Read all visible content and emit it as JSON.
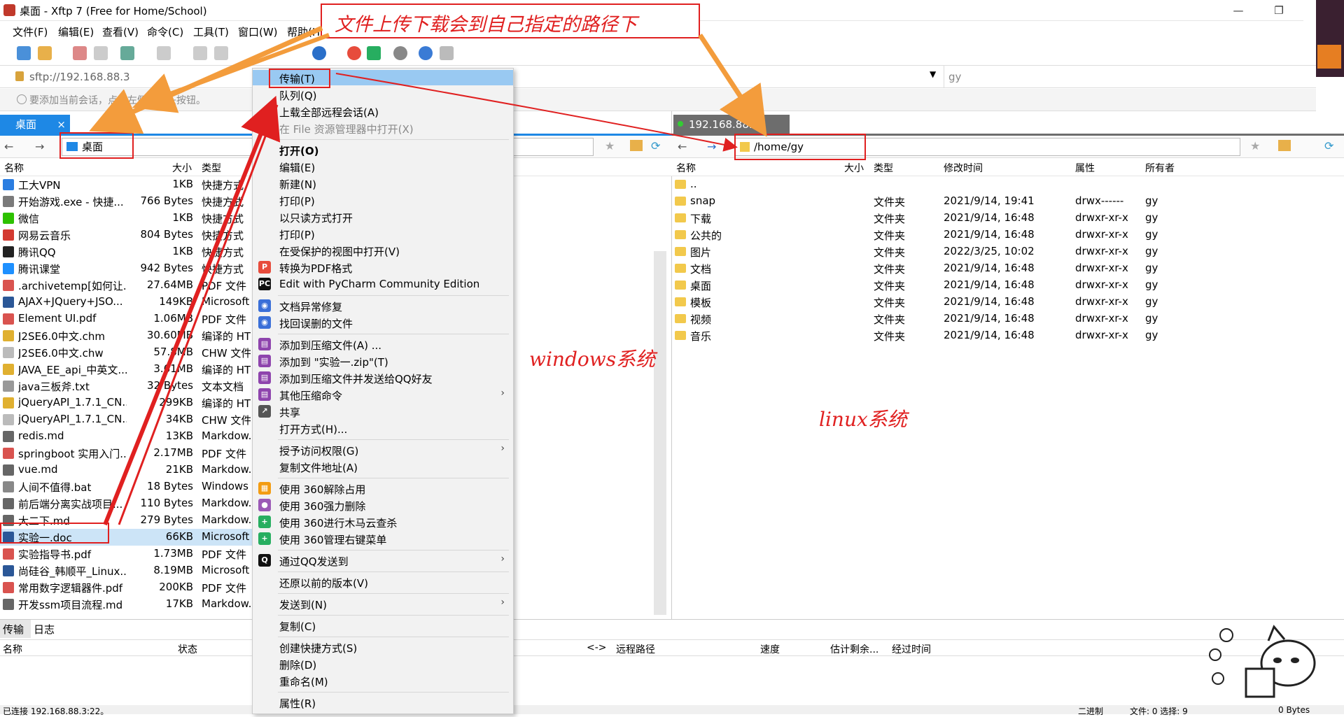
{
  "window": {
    "title": "桌面 - Xftp 7 (Free for Home/School)",
    "min": "—",
    "max": "❐",
    "close": "✕"
  },
  "menu": [
    "文件(F)",
    "编辑(E)",
    "查看(V)",
    "命令(C)",
    "工具(T)",
    "窗口(W)",
    "帮助(H)"
  ],
  "address": {
    "url": "sftp://192.168.88.3",
    "right_value": "gy"
  },
  "hint": "要添加当前会话，点击左侧的箭头按钮。",
  "left": {
    "tab": "桌面",
    "path": "桌面",
    "columns": [
      "名称",
      "大小",
      "类型"
    ],
    "files": [
      {
        "name": "工大VPN",
        "size": "1KB",
        "type": "快捷方式",
        "color": "#2a7de1"
      },
      {
        "name": "开始游戏.exe - 快捷...",
        "size": "766 Bytes",
        "type": "快捷方式",
        "color": "#7a7a7a"
      },
      {
        "name": "微信",
        "size": "1KB",
        "type": "快捷方式",
        "color": "#2dc100"
      },
      {
        "name": "网易云音乐",
        "size": "804 Bytes",
        "type": "快捷方式",
        "color": "#d33a31"
      },
      {
        "name": "腾讯QQ",
        "size": "1KB",
        "type": "快捷方式",
        "color": "#222"
      },
      {
        "name": "腾讯课堂",
        "size": "942 Bytes",
        "type": "快捷方式",
        "color": "#1e90ff"
      },
      {
        "name": ".archivetemp[如何让...",
        "size": "27.64MB",
        "type": "PDF 文件",
        "color": "#d9534f"
      },
      {
        "name": "AJAX+JQuery+JSO...",
        "size": "149KB",
        "type": "Microsoft",
        "color": "#2b5797"
      },
      {
        "name": "Element UI.pdf",
        "size": "1.06MB",
        "type": "PDF 文件",
        "color": "#d9534f"
      },
      {
        "name": "J2SE6.0中文.chm",
        "size": "30.60MB",
        "type": "编译的 HT",
        "color": "#e0b030"
      },
      {
        "name": "J2SE6.0中文.chw",
        "size": "57.8MB",
        "type": "CHW 文件",
        "color": "#bbb"
      },
      {
        "name": "JAVA_EE_api_中英文...",
        "size": "3.61MB",
        "type": "编译的 HT",
        "color": "#e0b030"
      },
      {
        "name": "java三板斧.txt",
        "size": "32 Bytes",
        "type": "文本文档",
        "color": "#999"
      },
      {
        "name": "jQueryAPI_1.7.1_CN...",
        "size": "299KB",
        "type": "编译的 HT",
        "color": "#e0b030"
      },
      {
        "name": "jQueryAPI_1.7.1_CN...",
        "size": "34KB",
        "type": "CHW 文件",
        "color": "#bbb"
      },
      {
        "name": "redis.md",
        "size": "13KB",
        "type": "Markdow.",
        "color": "#666"
      },
      {
        "name": "springboot 实用入门...",
        "size": "2.17MB",
        "type": "PDF 文件",
        "color": "#d9534f"
      },
      {
        "name": "vue.md",
        "size": "21KB",
        "type": "Markdow.",
        "color": "#666"
      },
      {
        "name": "人间不值得.bat",
        "size": "18 Bytes",
        "type": "Windows",
        "color": "#888"
      },
      {
        "name": "前后端分离实战项目...",
        "size": "110 Bytes",
        "type": "Markdow.",
        "color": "#666"
      },
      {
        "name": "大二下.md",
        "size": "279 Bytes",
        "type": "Markdow.",
        "color": "#666"
      },
      {
        "name": "实验一.doc",
        "size": "66KB",
        "type": "Microsoft",
        "color": "#2b5797"
      },
      {
        "name": "实验指导书.pdf",
        "size": "1.73MB",
        "type": "PDF 文件",
        "color": "#d9534f"
      },
      {
        "name": "尚硅谷_韩顺平_Linux...",
        "size": "8.19MB",
        "type": "Microsoft",
        "color": "#2b5797"
      },
      {
        "name": "常用数字逻辑器件.pdf",
        "size": "200KB",
        "type": "PDF 文件",
        "color": "#d9534f"
      },
      {
        "name": "开发ssm项目流程.md",
        "size": "17KB",
        "type": "Markdow.",
        "color": "#666"
      }
    ]
  },
  "right": {
    "tab": "192.168.88.3",
    "path": "/home/gy",
    "columns": [
      "名称",
      "大小",
      "类型",
      "修改时间",
      "属性",
      "所有者"
    ],
    "files": [
      {
        "name": "..",
        "type": "",
        "time": "",
        "attr": "",
        "owner": ""
      },
      {
        "name": "snap",
        "type": "文件夹",
        "time": "2021/9/14, 19:41",
        "attr": "drwx------",
        "owner": "gy"
      },
      {
        "name": "下载",
        "type": "文件夹",
        "time": "2021/9/14, 16:48",
        "attr": "drwxr-xr-x",
        "owner": "gy"
      },
      {
        "name": "公共的",
        "type": "文件夹",
        "time": "2021/9/14, 16:48",
        "attr": "drwxr-xr-x",
        "owner": "gy"
      },
      {
        "name": "图片",
        "type": "文件夹",
        "time": "2022/3/25, 10:02",
        "attr": "drwxr-xr-x",
        "owner": "gy"
      },
      {
        "name": "文档",
        "type": "文件夹",
        "time": "2021/9/14, 16:48",
        "attr": "drwxr-xr-x",
        "owner": "gy"
      },
      {
        "name": "桌面",
        "type": "文件夹",
        "time": "2021/9/14, 16:48",
        "attr": "drwxr-xr-x",
        "owner": "gy"
      },
      {
        "name": "模板",
        "type": "文件夹",
        "time": "2021/9/14, 16:48",
        "attr": "drwxr-xr-x",
        "owner": "gy"
      },
      {
        "name": "视频",
        "type": "文件夹",
        "time": "2021/9/14, 16:48",
        "attr": "drwxr-xr-x",
        "owner": "gy"
      },
      {
        "name": "音乐",
        "type": "文件夹",
        "time": "2021/9/14, 16:48",
        "attr": "drwxr-xr-x",
        "owner": "gy"
      }
    ]
  },
  "context_menu": [
    {
      "label": "传输(T)",
      "style": "hl"
    },
    {
      "label": "队列(Q)"
    },
    {
      "label": "上载全部远程会话(A)"
    },
    {
      "label": "在 File 资源管理器中打开(X)",
      "style": "dis"
    },
    {
      "sep": true
    },
    {
      "label": "打开(O)",
      "style": "bold"
    },
    {
      "label": "编辑(E)"
    },
    {
      "label": "新建(N)"
    },
    {
      "label": "打印(P)"
    },
    {
      "label": "以只读方式打开"
    },
    {
      "label": "打印(P)"
    },
    {
      "label": "在受保护的视图中打开(V)"
    },
    {
      "label": "转换为PDF格式",
      "icon": "P",
      "color": "#e74c3c"
    },
    {
      "label": "Edit with PyCharm Community Edition",
      "icon": "PC",
      "color": "#111"
    },
    {
      "sep": true
    },
    {
      "label": "文档异常修复",
      "icon": "◉",
      "color": "#3a6fd8"
    },
    {
      "label": "找回误删的文件",
      "icon": "◉",
      "color": "#3a6fd8"
    },
    {
      "sep": true
    },
    {
      "label": "添加到压缩文件(A) ...",
      "icon": "▤",
      "color": "#8e44ad"
    },
    {
      "label": "添加到 \"实验一.zip\"(T)",
      "icon": "▤",
      "color": "#8e44ad"
    },
    {
      "label": "添加到压缩文件并发送给QQ好友",
      "icon": "▤",
      "color": "#8e44ad"
    },
    {
      "label": "其他压缩命令",
      "icon": "▤",
      "color": "#8e44ad",
      "arrow": "›"
    },
    {
      "label": "共享",
      "icon": "↗",
      "color": "#555"
    },
    {
      "label": "打开方式(H)..."
    },
    {
      "sep": true
    },
    {
      "label": "授予访问权限(G)",
      "arrow": "›"
    },
    {
      "label": "复制文件地址(A)"
    },
    {
      "sep": true
    },
    {
      "label": "使用 360解除占用",
      "icon": "▦",
      "color": "#f39c12"
    },
    {
      "label": "使用 360强力删除",
      "icon": "●",
      "color": "#9b59b6"
    },
    {
      "label": "使用 360进行木马云查杀",
      "icon": "+",
      "color": "#27ae60"
    },
    {
      "label": "使用 360管理右键菜单",
      "icon": "+",
      "color": "#27ae60"
    },
    {
      "sep": true
    },
    {
      "label": "通过QQ发送到",
      "icon": "Q",
      "color": "#111",
      "arrow": "›"
    },
    {
      "sep": true
    },
    {
      "label": "还原以前的版本(V)"
    },
    {
      "sep": true
    },
    {
      "label": "发送到(N)",
      "arrow": "›"
    },
    {
      "sep": true
    },
    {
      "label": "复制(C)"
    },
    {
      "sep": true
    },
    {
      "label": "创建快捷方式(S)"
    },
    {
      "label": "删除(D)"
    },
    {
      "label": "重命名(M)"
    },
    {
      "sep": true
    },
    {
      "label": "属性(R)"
    }
  ],
  "bottom": {
    "tabs": [
      "传输",
      "日志"
    ],
    "columns": [
      "名称",
      "状态",
      "<->",
      "远程路径",
      "速度",
      "估计剩余...",
      "经过时间"
    ]
  },
  "status": {
    "left": "已连接 192.168.88.3:22。",
    "mid": "二进制",
    "files": "文件: 0  选择: 9",
    "size": "0 Bytes"
  },
  "annotations": {
    "top": "文件上传下载会到自己指定的路径下",
    "windows": "windows系统",
    "linux": "linux系统"
  }
}
